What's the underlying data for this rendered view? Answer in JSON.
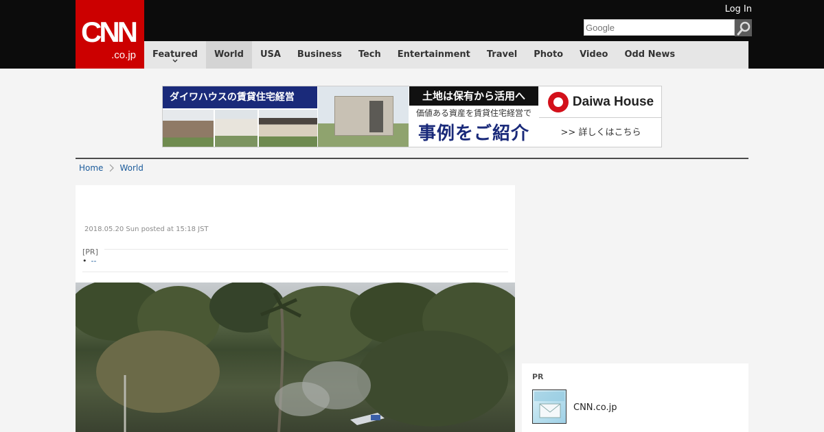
{
  "header": {
    "logo_main": "CNN",
    "logo_sub": ".co.jp",
    "login_label": "Log In",
    "search": {
      "placeholder": "Google"
    }
  },
  "nav": {
    "items": [
      {
        "label": "Featured"
      },
      {
        "label": "World"
      },
      {
        "label": "USA"
      },
      {
        "label": "Business"
      },
      {
        "label": "Tech"
      },
      {
        "label": "Entertainment"
      },
      {
        "label": "Travel"
      },
      {
        "label": "Photo"
      },
      {
        "label": "Video"
      },
      {
        "label": "Odd News"
      }
    ],
    "active": "World"
  },
  "banner": {
    "title": "ダイワハウスの賃貸住宅経営",
    "headline": "土地は保有から活用へ",
    "sub": "価値ある資産を賃貸住宅経営で",
    "big": "事例をご紹介",
    "brand": "Daiwa House",
    "more": ">> 詳しくはこちら"
  },
  "breadcrumb": {
    "home": "Home",
    "current": "World"
  },
  "article": {
    "date": "2018.05.20 Sun posted at 15:18 JST",
    "pr_label": "[PR]",
    "pr_link": "--"
  },
  "sidebar": {
    "pr_title": "PR",
    "pr_item": "CNN.co.jp"
  },
  "colors": {
    "brand_red": "#cc0000",
    "link_blue": "#1b5b9b",
    "header_bg": "#0c0c0c"
  }
}
